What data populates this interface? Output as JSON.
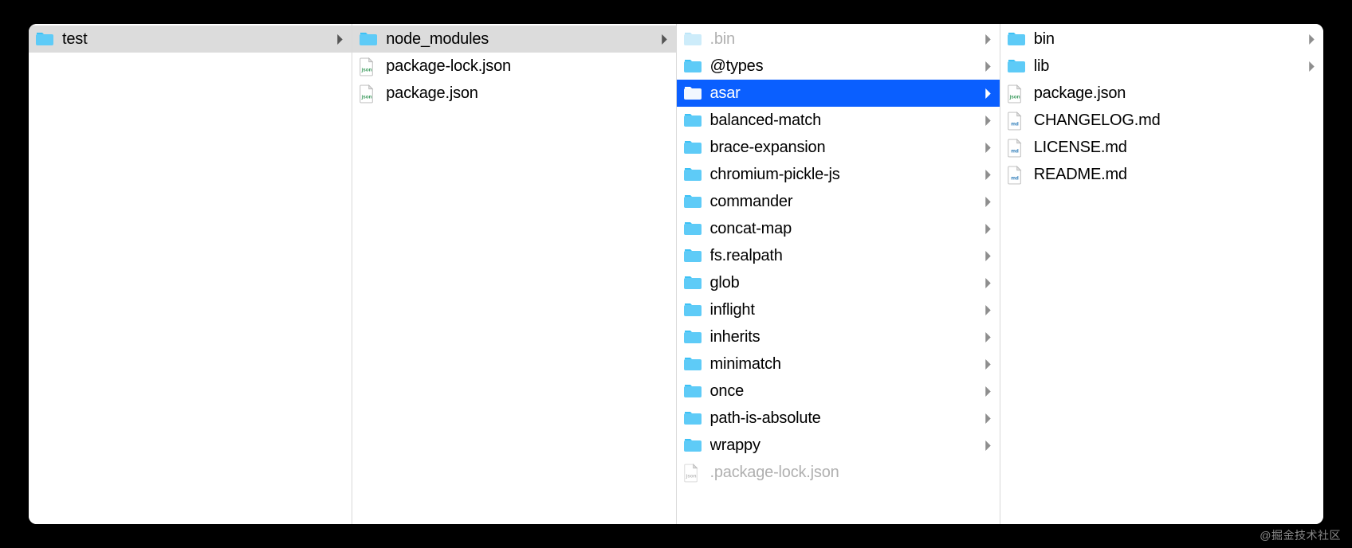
{
  "watermark": "@掘金技术社区",
  "columns": [
    {
      "id": "col0",
      "items": [
        {
          "name": "test",
          "type": "folder",
          "hasChildren": true,
          "state": "path"
        }
      ]
    },
    {
      "id": "col1",
      "items": [
        {
          "name": "node_modules",
          "type": "folder",
          "hasChildren": true,
          "state": "path"
        },
        {
          "name": "package-lock.json",
          "type": "file",
          "ext": "json"
        },
        {
          "name": "package.json",
          "type": "file",
          "ext": "json"
        }
      ]
    },
    {
      "id": "col2",
      "items": [
        {
          "name": ".bin",
          "type": "folder",
          "hasChildren": true,
          "dimmed": true
        },
        {
          "name": "@types",
          "type": "folder",
          "hasChildren": true
        },
        {
          "name": "asar",
          "type": "folder",
          "hasChildren": true,
          "state": "selected"
        },
        {
          "name": "balanced-match",
          "type": "folder",
          "hasChildren": true
        },
        {
          "name": "brace-expansion",
          "type": "folder",
          "hasChildren": true
        },
        {
          "name": "chromium-pickle-js",
          "type": "folder",
          "hasChildren": true
        },
        {
          "name": "commander",
          "type": "folder",
          "hasChildren": true
        },
        {
          "name": "concat-map",
          "type": "folder",
          "hasChildren": true
        },
        {
          "name": "fs.realpath",
          "type": "folder",
          "hasChildren": true
        },
        {
          "name": "glob",
          "type": "folder",
          "hasChildren": true
        },
        {
          "name": "inflight",
          "type": "folder",
          "hasChildren": true
        },
        {
          "name": "inherits",
          "type": "folder",
          "hasChildren": true
        },
        {
          "name": "minimatch",
          "type": "folder",
          "hasChildren": true
        },
        {
          "name": "once",
          "type": "folder",
          "hasChildren": true
        },
        {
          "name": "path-is-absolute",
          "type": "folder",
          "hasChildren": true
        },
        {
          "name": "wrappy",
          "type": "folder",
          "hasChildren": true
        },
        {
          "name": ".package-lock.json",
          "type": "file",
          "ext": "json",
          "dimmed": true
        }
      ]
    },
    {
      "id": "col3",
      "items": [
        {
          "name": "bin",
          "type": "folder",
          "hasChildren": true
        },
        {
          "name": "lib",
          "type": "folder",
          "hasChildren": true
        },
        {
          "name": "package.json",
          "type": "file",
          "ext": "json"
        },
        {
          "name": "CHANGELOG.md",
          "type": "file",
          "ext": "md"
        },
        {
          "name": "LICENSE.md",
          "type": "file",
          "ext": "md"
        },
        {
          "name": "README.md",
          "type": "file",
          "ext": "md"
        }
      ]
    }
  ]
}
